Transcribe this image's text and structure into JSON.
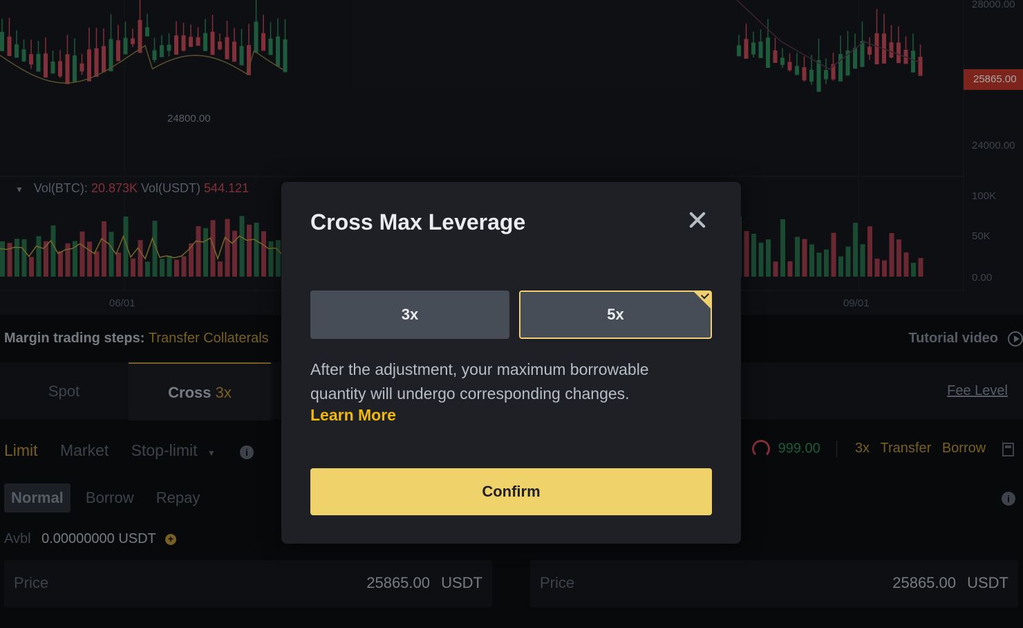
{
  "chart": {
    "price_labels": [
      "28000.00",
      "24000.00"
    ],
    "current_price_tag": "25865.00",
    "low_marker": "24800.00",
    "volume_axis": [
      "100K",
      "50K",
      "0.00"
    ],
    "volume": {
      "btc_label": "Vol(BTC):",
      "btc_value": "20.873K",
      "usdt_label": "Vol(USDT)",
      "usdt_value": "544.121"
    },
    "date_labels": [
      "06/01",
      "09/01"
    ],
    "colors": {
      "up": "#2f8a5c",
      "down": "#c84a5a"
    }
  },
  "steps": {
    "label": "Margin trading steps:",
    "link": "Transfer Collaterals"
  },
  "tutorial_label": "Tutorial video",
  "tabs": {
    "spot": "Spot",
    "cross": "Cross",
    "cross_leverage": "3x"
  },
  "fee_level": "Fee Level",
  "order_types": {
    "limit": "Limit",
    "market": "Market",
    "stop_limit": "Stop-limit"
  },
  "risk": {
    "value": "999.00",
    "leverage": "3x",
    "transfer": "Transfer",
    "borrow": "Borrow"
  },
  "subtabs": {
    "normal": "Normal",
    "borrow": "Borrow",
    "repay": "Repay"
  },
  "avbl": {
    "label": "Avbl",
    "value": "0.00000000 USDT"
  },
  "price_fields": {
    "left": {
      "label": "Price",
      "value": "25865.00",
      "unit": "USDT"
    },
    "right": {
      "label": "Price",
      "value": "25865.00",
      "unit": "USDT"
    }
  },
  "modal": {
    "title": "Cross Max Leverage",
    "options": [
      "3x",
      "5x"
    ],
    "selected": "5x",
    "description": "After the adjustment, your maximum borrowable quantity will undergo corresponding changes.",
    "learn_more": "Learn More",
    "confirm": "Confirm",
    "accent": "#f0d26b"
  }
}
